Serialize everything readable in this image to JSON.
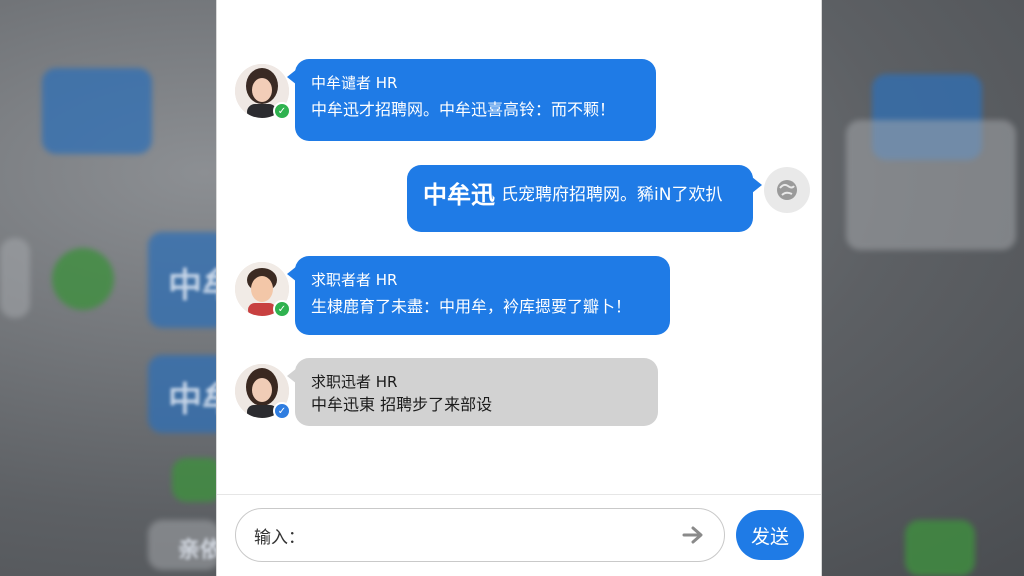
{
  "messages": [
    {
      "sender_name": "中牟谴者 HR",
      "text": "中牟迅才招聘网。中牟迅喜高铃：而不颗！",
      "badge": "check"
    },
    {
      "text_big": "中牟迅",
      "text": "氏宠聘府招聘网。豨iN了欢扒"
    },
    {
      "sender_name": "求职者者 HR",
      "text": "生棣鹿育了未盡：中用牟，衿库摁要了瓣卜！",
      "badge": "check"
    },
    {
      "sender_name": "求职迅者 HR",
      "text": "中牟迅東 招聘步了来部设",
      "badge": "check"
    }
  ],
  "composer": {
    "label": "输入：",
    "value": "",
    "send_label": "发送"
  },
  "colors": {
    "accent": "#1f7be6",
    "incoming_gray": "#d2d2d2",
    "badge_green": "#2fb24f"
  },
  "background_text": [
    "中牟",
    "中牟",
    "亲依"
  ]
}
